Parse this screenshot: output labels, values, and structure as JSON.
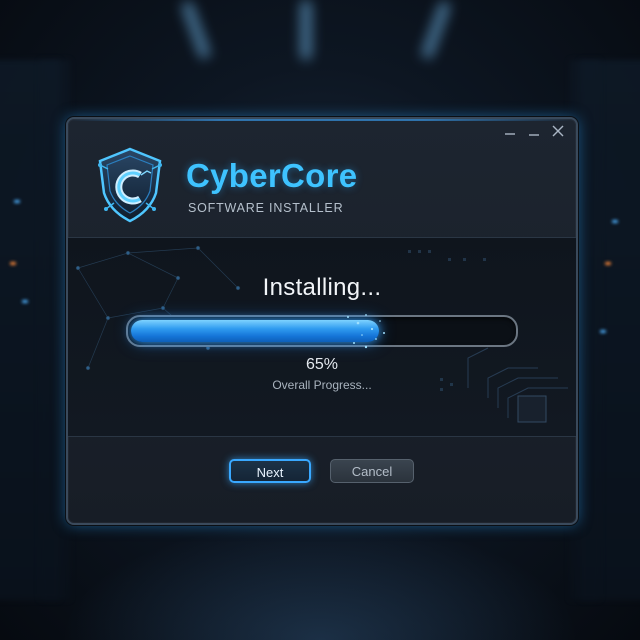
{
  "window": {
    "controls": {
      "minimize_icon": "minimize-icon",
      "maximize_icon": "maximize-icon",
      "close_icon": "close-icon"
    }
  },
  "brand": {
    "name": "CyberCore",
    "subtitle": "SOFTWARE INSTALLER",
    "logo_letter": "C",
    "accent_color": "#3ec3ff"
  },
  "install": {
    "status": "Installing...",
    "progress_fraction": 0.65,
    "percent_text": "65%",
    "progress_label": "Overall Progress...",
    "fill_color": "#2f9bf0"
  },
  "buttons": {
    "next_label": "Next",
    "cancel_label": "Cancel"
  }
}
